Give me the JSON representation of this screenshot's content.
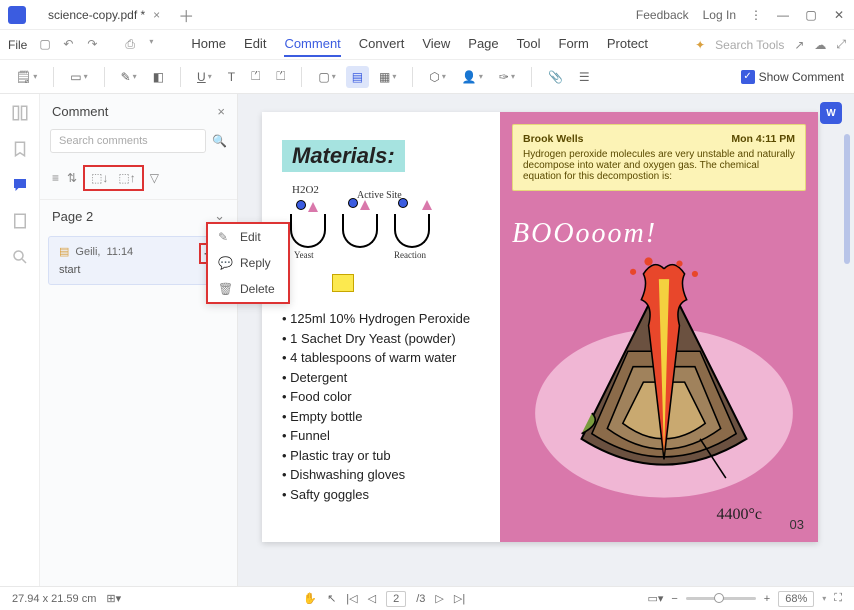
{
  "titlebar": {
    "tab_name": "science-copy.pdf *",
    "feedback": "Feedback",
    "login": "Log In"
  },
  "menubar": {
    "file": "File",
    "tabs": [
      "Home",
      "Edit",
      "Comment",
      "Convert",
      "View",
      "Page",
      "Tool",
      "Form",
      "Protect"
    ],
    "active_tab": 2,
    "search_placeholder": "Search Tools"
  },
  "toolbar": {
    "show_comment": "Show Comment"
  },
  "panel": {
    "title": "Comment",
    "search_placeholder": "Search comments",
    "page_label": "Page 2",
    "comment": {
      "author": "Geili,",
      "time": "11:14",
      "body": "start"
    }
  },
  "context_menu": {
    "edit": "Edit",
    "reply": "Reply",
    "delete": "Delete"
  },
  "document": {
    "materials_title": "Materials:",
    "h2o2": "H2O2",
    "active_site": "Active Site",
    "flask_labels": [
      "Yeast",
      "",
      "Reaction"
    ],
    "materials": [
      "125ml 10% Hydrogen Peroxide",
      "1 Sachet Dry Yeast (powder)",
      "4 tablespoons of warm water",
      "Detergent",
      "Food color",
      "Empty bottle",
      "Funnel",
      "Plastic tray or tub",
      "Dishwashing gloves",
      "Safty goggles"
    ],
    "sticky": {
      "author": "Brook Wells",
      "time": "Mon 4:11 PM",
      "text": "Hydrogen peroxide molecules are very unstable and naturally decompose into water and oxygen gas. The chemical equation for this decompostion is:"
    },
    "boom": "BOOooom!",
    "temperature": "4400°c",
    "page_number": "03"
  },
  "statusbar": {
    "dimensions": "27.94 x 21.59 cm",
    "page_current": "2",
    "page_total": "/3",
    "zoom": "68%"
  }
}
